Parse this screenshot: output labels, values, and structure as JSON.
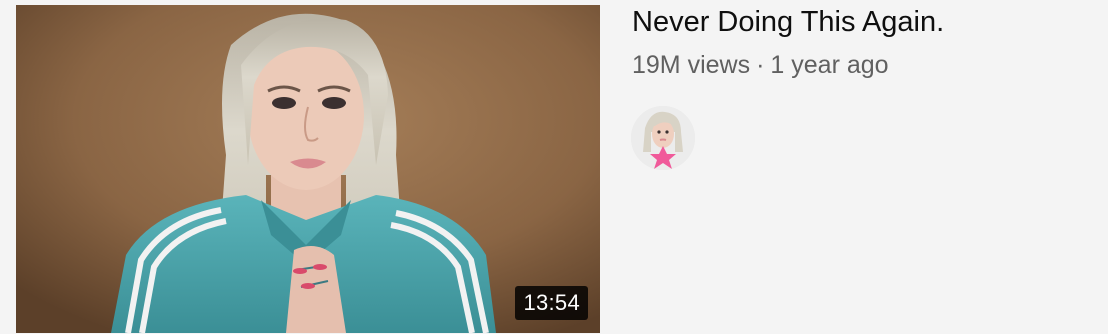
{
  "video": {
    "title": "Never Doing This Again.",
    "views": "19M views",
    "separator": "·",
    "age": "1 year ago",
    "duration": "13:54"
  },
  "thumbnail": {
    "subject": "person in teal tracksuit",
    "background_color": "#8a6544",
    "jacket_color": "#4fa7ad",
    "hair_color": "#d8d4c8"
  },
  "channel": {
    "avatar_icon": "channel-avatar",
    "avatar_accent_color": "#f05a9a"
  }
}
